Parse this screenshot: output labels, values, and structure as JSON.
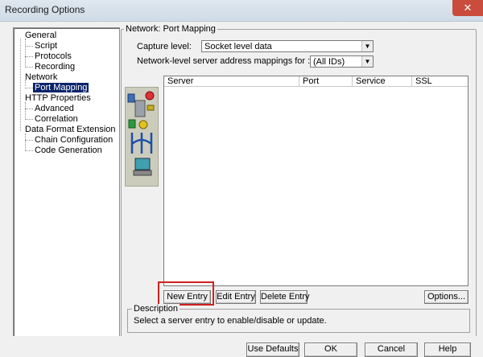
{
  "window": {
    "title": "Recording Options",
    "close_glyph": "✕"
  },
  "tree": {
    "items": [
      {
        "label": "General",
        "level": 0
      },
      {
        "label": "Script",
        "level": 1
      },
      {
        "label": "Protocols",
        "level": 1
      },
      {
        "label": "Recording",
        "level": 1
      },
      {
        "label": "Network",
        "level": 0
      },
      {
        "label": "Port Mapping",
        "level": 1,
        "selected": true
      },
      {
        "label": "HTTP Properties",
        "level": 0
      },
      {
        "label": "Advanced",
        "level": 1
      },
      {
        "label": "Correlation",
        "level": 1
      },
      {
        "label": "Data Format Extension",
        "level": 0
      },
      {
        "label": "Chain Configuration",
        "level": 1
      },
      {
        "label": "Code Generation",
        "level": 1
      }
    ]
  },
  "panel": {
    "group_title": "Network: Port Mapping",
    "capture_level": {
      "label": "Capture level:",
      "value": "Socket level data"
    },
    "mappings_for": {
      "label": "Network-level server address mappings for :",
      "value": "(All IDs)"
    }
  },
  "table": {
    "columns": [
      "Server",
      "Port",
      "Service",
      "SSL"
    ],
    "rows": []
  },
  "buttons": {
    "new_entry": "New Entry",
    "edit_entry": "Edit Entry",
    "delete_entry": "Delete Entry",
    "options": "Options..."
  },
  "description": {
    "title": "Description",
    "text": "Select a server entry to enable/disable or update."
  },
  "footer": {
    "use_defaults": "Use Defaults",
    "ok": "OK",
    "cancel": "Cancel",
    "help": "Help"
  },
  "colors": {
    "selection": "#0a246a",
    "highlight_box": "#d02020",
    "dialog_bg": "#f0f0f0"
  }
}
